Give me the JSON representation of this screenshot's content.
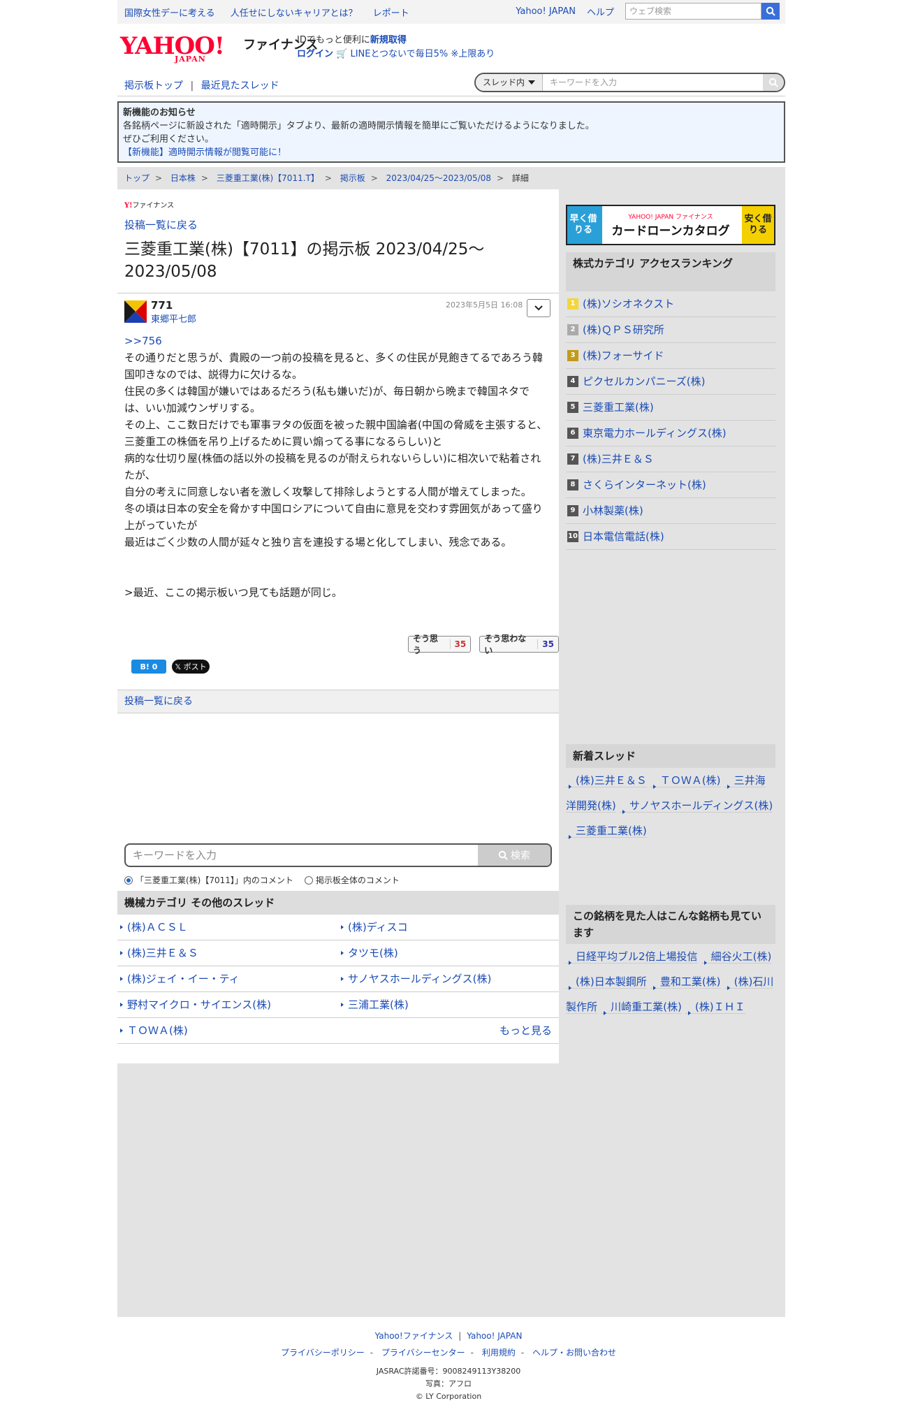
{
  "promo": {
    "links": [
      "国際女性デーに考える",
      "人任せにしないキャリアとは？",
      "レポート"
    ],
    "yahoo_japan": "Yahoo! JAPAN",
    "help": "ヘルプ",
    "web_search_placeholder": "ウェブ検索"
  },
  "header": {
    "logo_text": "YAHOO!",
    "logo_sub": "JAPAN",
    "finance": "ファイナンス",
    "id_prefix": "IDでもっと便利に",
    "id_link": "新規取得",
    "login": "ログイン",
    "line_promo": "LINEとつないで毎日5% ※上限あり"
  },
  "nav": {
    "board_top": "掲示板トップ",
    "divider": "|",
    "recent": "最近見たスレッド",
    "scope": "スレッド内",
    "keyword_placeholder": "キーワードを入力"
  },
  "notice": {
    "title": "新機能のお知らせ",
    "line1": "各銘柄ページに新設された「適時開示」タブより、最新の適時開示情報を簡単にご覧いただけるようになりました。",
    "line2": "ぜひご利用ください。",
    "link": "【新機能】適時開示情報が閲覧可能に！"
  },
  "breadcrumb": {
    "items": [
      "トップ",
      "日本株",
      "三菱重工業(株)【7011.T】",
      "掲示板",
      "2023/04/25～2023/05/08",
      "詳細"
    ],
    "sep": ">"
  },
  "main": {
    "mini_logo_y": "Y!",
    "mini_logo_text": "ファイナンス",
    "back_link": "投稿一覧に戻る",
    "title": "三菱重工業(株)【7011】の掲示板 2023/04/25～2023/05/08"
  },
  "post": {
    "number": "771",
    "author": "東郷平七郎",
    "date": "2023年5月5日 16:08",
    "reply_link": ">>756",
    "lines": [
      "その通りだと思うが、貴殿の一つ前の投稿を見ると、多くの住民が見飽きてるであろう韓国叩きなのでは、説得力に欠けるな。",
      "住民の多くは韓国が嫌いではあるだろう(私も嫌いだ)が、毎日朝から晩まで韓国ネタでは、いい加減ウンザリする。",
      "その上、ここ数日だけでも軍事ヲタの仮面を被った親中国論者(中国の脅威を主張すると、三菱重工の株価を吊り上げるために買い煽ってる事になるらしい)と",
      "病的な仕切り屋(株価の話以外の投稿を見るのが耐えられないらしい)に相次いで粘着されたが、",
      "自分の考えに同意しない者を激しく攻撃して排除しようとする人間が増えてしまった。",
      "冬の頃は日本の安全を脅かす中国ロシアについて自由に意見を交わす雰囲気があって盛り上がっていたが",
      "最近はごく少数の人間が延々と独り言を連投する場と化してしまい、残念である。"
    ],
    "quote": ">最近、ここの掲示板いつ見ても話題が同じ。",
    "agree_label": "そう思う",
    "agree_count": "35",
    "disagree_label": "そう思わない",
    "disagree_count": "35",
    "hatena_label": "B! 0",
    "x_label": "𝕏 ポスト"
  },
  "back2": "投稿一覧に戻る",
  "bottom_search": {
    "placeholder": "キーワードを入力",
    "button": "検索",
    "radio_thread": "「三菱重工業(株)【7011】」内のコメント",
    "radio_all": "掲示板全体のコメント"
  },
  "other_threads": {
    "title": "機械カテゴリ その他のスレッド",
    "items": [
      "(株)ＡＣＳＬ",
      "(株)ディスコ",
      "(株)三井Ｅ＆Ｓ",
      "タツモ(株)",
      "(株)ジェイ・イー・ティ",
      "サノヤスホールディングス(株)",
      "野村マイクロ・サイエンス(株)",
      "三浦工業(株)",
      "ＴＯＷＡ(株)"
    ],
    "more": "もっと見る"
  },
  "sidebar": {
    "banner_left": "早く借りる",
    "banner_brand": "YAHOO! JAPAN ファイナンス",
    "banner_main": "カードローンカタログ",
    "banner_right": "安く借りる",
    "ranking_title": "株式カテゴリ アクセスランキング",
    "ranking": [
      "(株)ソシオネクスト",
      "(株)ＱＰＳ研究所",
      "(株)フォーサイド",
      "ピクセルカンパニーズ(株)",
      "三菱重工業(株)",
      "東京電力ホールディングス(株)",
      "(株)三井Ｅ＆Ｓ",
      "さくらインターネット(株)",
      "小林製薬(株)",
      "日本電信電話(株)"
    ],
    "new_threads_title": "新着スレッド",
    "new_threads": [
      "(株)三井Ｅ＆Ｓ",
      "ＴＯＷＡ(株)",
      "三井海洋開発(株)",
      "サノヤスホールディングス(株)",
      "三菱重工業(株)"
    ],
    "seen_title": "この銘柄を見た人はこんな銘柄も見ています",
    "seen": [
      "日経平均ブル2倍上場投信",
      "細谷火工(株)",
      "(株)日本製鋼所",
      "豊和工業(株)",
      "(株)石川製作所",
      "川崎重工業(株)",
      "(株)ＩＨＩ"
    ]
  },
  "footer": {
    "finance": "Yahoo!ファイナンス",
    "yahoo": "Yahoo! JAPAN",
    "privacy_policy": "プライバシーポリシー",
    "privacy_center": "プライバシーセンター",
    "terms": "利用規約",
    "help": "ヘルプ・お問い合わせ",
    "jasrac": "JASRAC許諾番号：9008249113Y38200",
    "photo": "写真：アフロ",
    "copyright": "© LY Corporation"
  },
  "colors": {
    "link": "#1b4cb5",
    "brand": "#ff0033"
  }
}
